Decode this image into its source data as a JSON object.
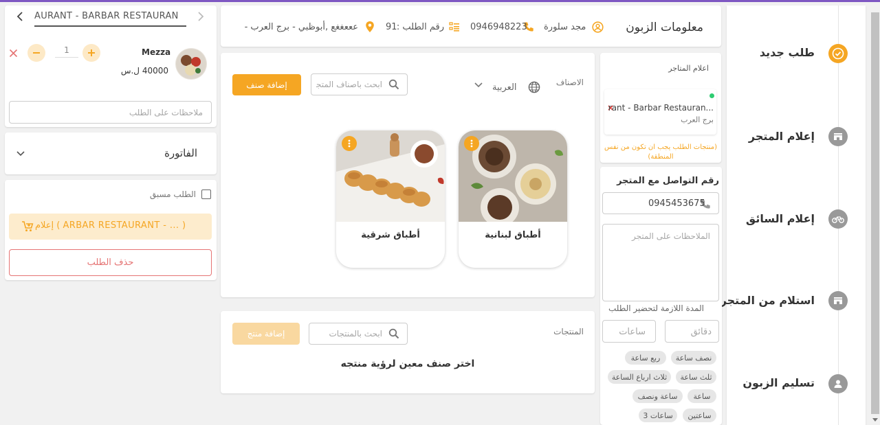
{
  "colors": {
    "accent": "#f5a623",
    "danger": "#e57373",
    "purple": "#7e57c2",
    "grey_icon": "#8a8a8a"
  },
  "steps": [
    {
      "label": "طلب جديد",
      "icon": "check-circle-icon",
      "active": true
    },
    {
      "label": "إعلام المتجر",
      "icon": "store-icon",
      "active": false
    },
    {
      "label": "إعلام السائق",
      "icon": "bicycle-icon",
      "active": false
    },
    {
      "label": "استلام من المتجر",
      "icon": "store-icon",
      "active": false
    },
    {
      "label": "تسليم الزبون",
      "icon": "person-icon",
      "active": false
    }
  ],
  "customer": {
    "title": "معلومات الزبون",
    "name": "مجد سلورة",
    "phone": "0946948223",
    "order_label": "رقم الطلب :",
    "order_number": "91",
    "address": "عععغغع ,أبوظبي - برج العرب -"
  },
  "store_notice": {
    "title": "اعلام المتاجر",
    "store_name": "rant - Barbar Restauran...",
    "store_area": "برج العرب",
    "warning": "(منتجات الطلب يجب ان تكون من نفس المنطقة)"
  },
  "contact": {
    "title": "رقم التواصل مع المتجر",
    "phone": "0945453675",
    "notes_placeholder": "الملاحظات على المتجر",
    "prep_label": "المدة اللازمة لتحضير الطلب",
    "minutes_placeholder": "دقائق",
    "hours_placeholder": "ساعات",
    "chips": [
      "نصف ساعة",
      "ربع ساعة",
      "ثلث ساعة",
      "ثلاث ارباع الساعة",
      "ساعة",
      "ساعة ونصف",
      "ساعتين",
      "3 ساعات"
    ]
  },
  "categories": {
    "label": "الاصناف",
    "language": "العربية",
    "search_placeholder": "ابحث باصناف المتجر",
    "add_button": "إضافة صنف",
    "items": [
      {
        "name": "أطباق لبنانية",
        "image": "lebanese-dishes-photo"
      },
      {
        "name": "أطباق شرقية",
        "image": "oriental-dishes-photo"
      }
    ]
  },
  "products": {
    "label": "المنتجات",
    "search_placeholder": "ابحث بالمنتجات",
    "add_button": "إضافة منتج",
    "empty_message": "اختر صنف معين لرؤية منتجه"
  },
  "cart": {
    "store_tab": "AURANT - BARBAR RESTAURAN",
    "item_name": "Mezza",
    "item_price": "40000 ل.س",
    "quantity": "1",
    "notes_placeholder": "ملاحظات على الطلب",
    "invoice_title": "الفاتورة",
    "preorder_label": "الطلب مسبق",
    "notify_button": "إعلام ( ARBAR RESTAURANT - ... )",
    "delete_button": "حذف الطلب"
  }
}
